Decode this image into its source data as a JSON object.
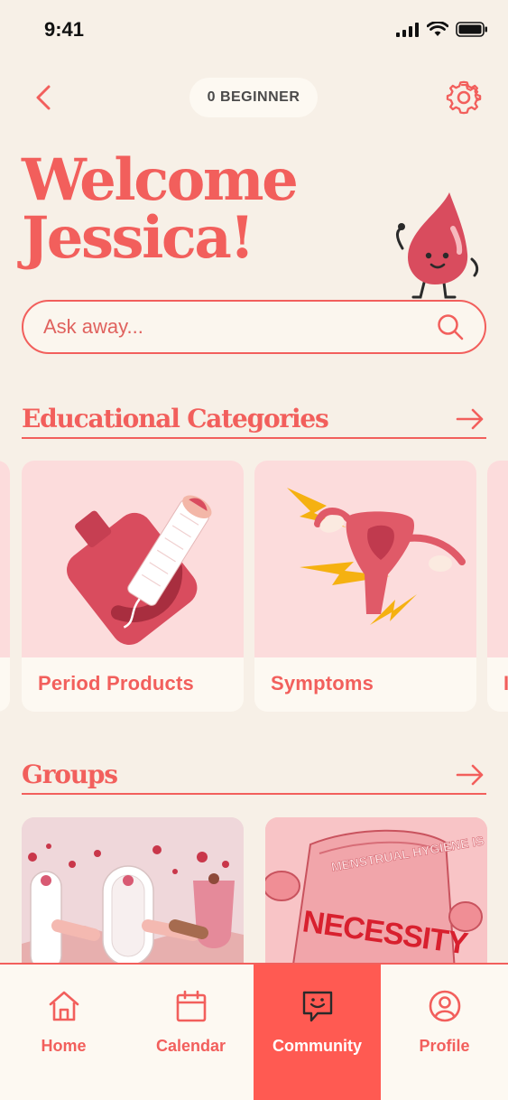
{
  "status_bar": {
    "time": "9:41"
  },
  "header": {
    "level_label": "0 BEGINNER"
  },
  "welcome": {
    "line1": "Welcome",
    "line2": "Jessica!"
  },
  "search": {
    "placeholder": "Ask away..."
  },
  "educational": {
    "title": "Educational Categories",
    "cards": [
      {
        "label": "Period Products"
      },
      {
        "label": "Symptoms"
      },
      {
        "label": "I"
      }
    ]
  },
  "groups": {
    "title": "Groups",
    "cards": [
      {
        "image": "friends-holding-hands"
      },
      {
        "image": "menstrual-hygiene-is-a-necessity-pillow",
        "text_top": "MENSTRUAL HYGIENE IS A",
        "text_main": "NECESSITY"
      }
    ]
  },
  "tabbar": {
    "tabs": [
      {
        "label": "Home",
        "icon": "home-icon"
      },
      {
        "label": "Calendar",
        "icon": "calendar-icon"
      },
      {
        "label": "Community",
        "icon": "community-icon",
        "active": true
      },
      {
        "label": "Profile",
        "icon": "profile-icon"
      }
    ]
  },
  "colors": {
    "accent": "#F25F5C",
    "active_tab": "#FF5A52",
    "background": "#F7F0E7",
    "card_image_bg": "#FCDCDC"
  }
}
